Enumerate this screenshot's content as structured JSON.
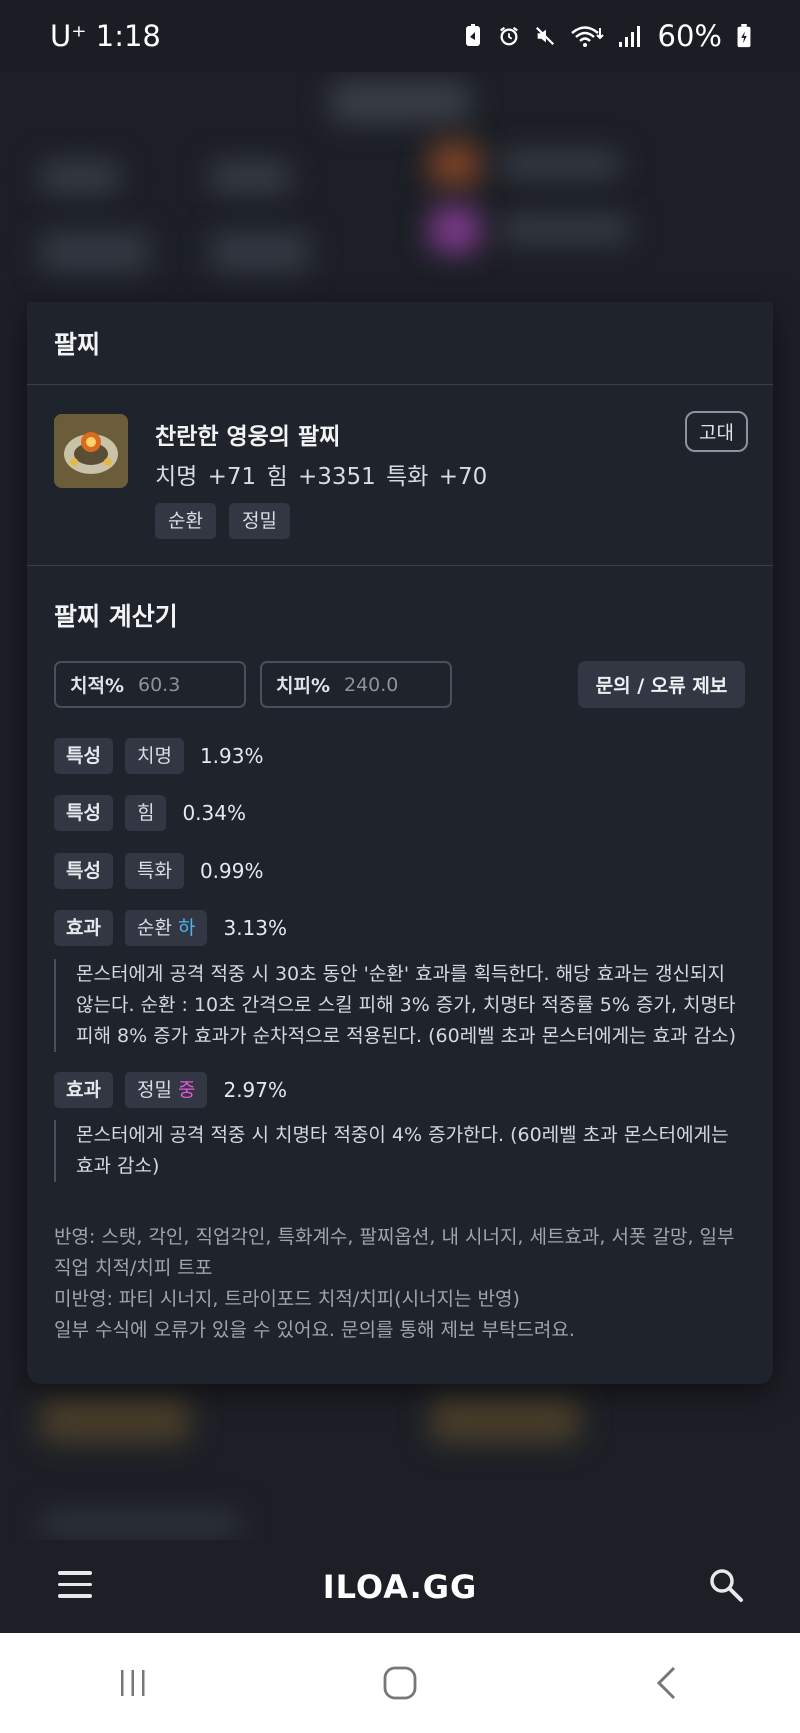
{
  "status_bar": {
    "carrier_time": "U⁺ 1:18",
    "battery": "60%",
    "icons": [
      "battery-saver-icon",
      "alarm-icon",
      "mute-icon",
      "wifi-icon",
      "signal-icon",
      "battery-icon"
    ]
  },
  "panel": {
    "title": "팔찌"
  },
  "item": {
    "name": "찬란한 영웅의 팔찌",
    "stats": "치명 +71  힘 +3351  특화 +70",
    "grade": "고대",
    "tags": [
      "순환",
      "정밀"
    ]
  },
  "calculator": {
    "title": "팔찌 계산기",
    "crit_rate_label": "치적%",
    "crit_rate_value": "60.3",
    "crit_dmg_label": "치피%",
    "crit_dmg_value": "240.0",
    "report_button": "문의 / 오류 제보",
    "traits": [
      {
        "type": "특성",
        "name": "치명",
        "value": "1.93%"
      },
      {
        "type": "특성",
        "name": "힘",
        "value": "0.34%"
      },
      {
        "type": "특성",
        "name": "특화",
        "value": "0.99%"
      }
    ],
    "effects": [
      {
        "type": "효과",
        "name": "순환",
        "tier": "하",
        "value": "3.13%",
        "description": "몬스터에게 공격 적중 시 30초 동안 '순환' 효과를 획득한다. 해당 효과는 갱신되지 않는다. 순환 : 10초 간격으로 스킬 피해 3% 증가, 치명타 적중률 5% 증가, 치명타 피해 8% 증가 효과가 순차적으로 적용된다. (60레벨 초과 몬스터에게는 효과 감소)"
      },
      {
        "type": "효과",
        "name": "정밀",
        "tier": "중",
        "value": "2.97%",
        "description": "몬스터에게 공격 적중 시 치명타 적중이 4% 증가한다. (60레벨 초과 몬스터에게는 효과 감소)"
      }
    ],
    "footnotes": [
      "반영: 스탯, 각인, 직업각인, 특화계수, 팔찌옵션, 내 시너지, 세트효과, 서폿 갈망, 일부 직업 치적/치피 트포",
      "미반영: 파티 시너지, 트라이포드 치적/치피(시너지는 반영)",
      "일부 수식에 오류가 있을 수 있어요. 문의를 통해 제보 부탁드려요."
    ]
  },
  "app_bar": {
    "brand": "ILOA.GG"
  },
  "colors": {
    "tier_low": "#4fb3f0",
    "tier_mid": "#e05ad6",
    "card_bg": "#1f232b",
    "chip_bg": "#323743"
  }
}
